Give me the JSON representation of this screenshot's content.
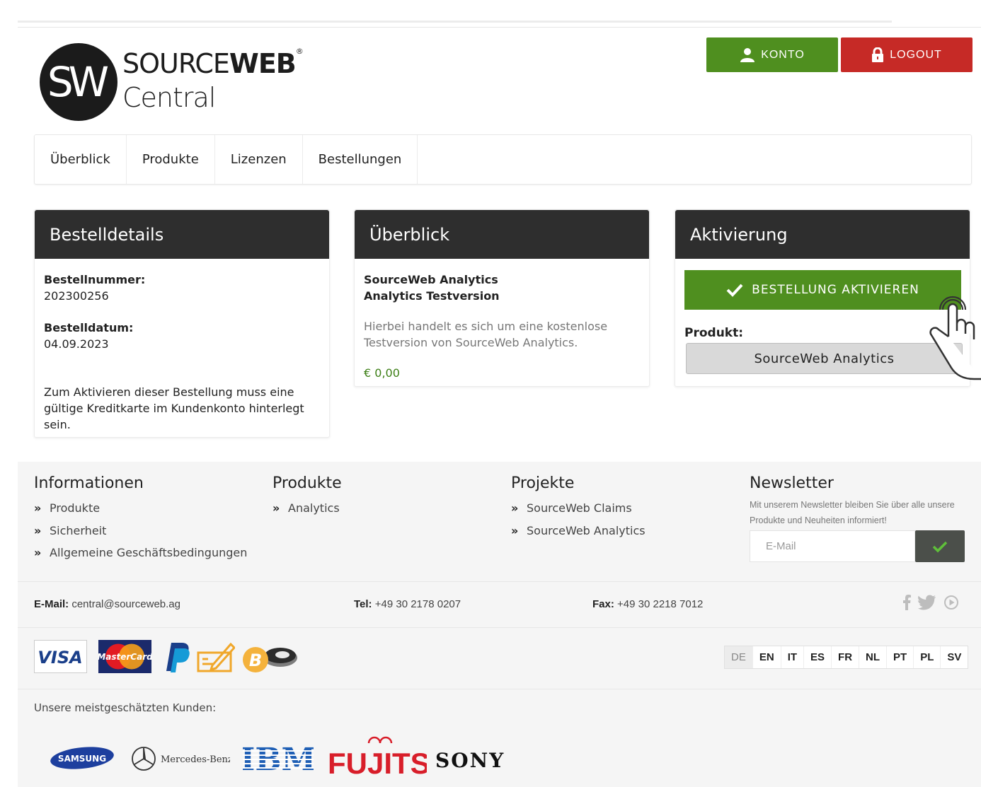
{
  "brand": {
    "name_light": "SOURCE",
    "name_bold": "WEB",
    "registered": "®",
    "subtitle": "Central",
    "monogram": "SW"
  },
  "header": {
    "konto_label": "KONTO",
    "logout_label": "LOGOUT"
  },
  "nav": {
    "items": [
      "Überblick",
      "Produkte",
      "Lizenzen",
      "Bestellungen"
    ]
  },
  "order_details": {
    "title": "Bestelldetails",
    "number_label": "Bestellnummer:",
    "number": "202300256",
    "date_label": "Bestelldatum:",
    "date": "04.09.2023",
    "notice": "Zum Aktivieren dieser Bestellung muss eine gültige Kreditkarte im Kundenkonto hinterlegt sein."
  },
  "overview": {
    "title": "Überblick",
    "product": "SourceWeb Analytics",
    "edition": "Analytics Testversion",
    "description": "Hierbei handelt es sich um eine kostenlose Testversion von SourceWeb Analytics.",
    "price": "€ 0,00"
  },
  "activation": {
    "title": "Aktivierung",
    "activate_label": "BESTELLUNG AKTIVIEREN",
    "product_label": "Produkt:",
    "product_button": "SourceWeb Analytics"
  },
  "footer": {
    "info": {
      "title": "Informationen",
      "links": [
        "Produkte",
        "Sicherheit",
        "Allgemeine Geschäftsbedingungen"
      ]
    },
    "products": {
      "title": "Produkte",
      "links": [
        "Analytics"
      ]
    },
    "projects": {
      "title": "Projekte",
      "links": [
        "SourceWeb Claims",
        "SourceWeb Analytics"
      ]
    },
    "newsletter": {
      "title": "Newsletter",
      "text": "Mit unserem Newsletter bleiben Sie über alle unsere Produkte und Neuheiten informiert!",
      "placeholder": "E-Mail"
    },
    "contact": {
      "email_label": "E-Mail:",
      "email": "central@sourceweb.ag",
      "tel_label": "Tel:",
      "tel": "+49 30 2178 0207",
      "fax_label": "Fax:",
      "fax": "+49 30 2218 7012"
    },
    "payment": {
      "visa": "VISA",
      "mastercard": "MasterCard"
    },
    "languages": [
      "DE",
      "EN",
      "IT",
      "ES",
      "FR",
      "NL",
      "PT",
      "PL",
      "SV"
    ],
    "customers_label": "Unsere meistgeschätzten Kunden:",
    "customers": {
      "samsung": "SAMSUNG",
      "mercedes": "Mercedes-Benz",
      "ibm": "IBM",
      "fujitsu": "FUJITSU",
      "sony": "SONY"
    }
  },
  "colors": {
    "green": "#4f8f1f",
    "red": "#c62a26",
    "dark": "#2e2e2e"
  }
}
